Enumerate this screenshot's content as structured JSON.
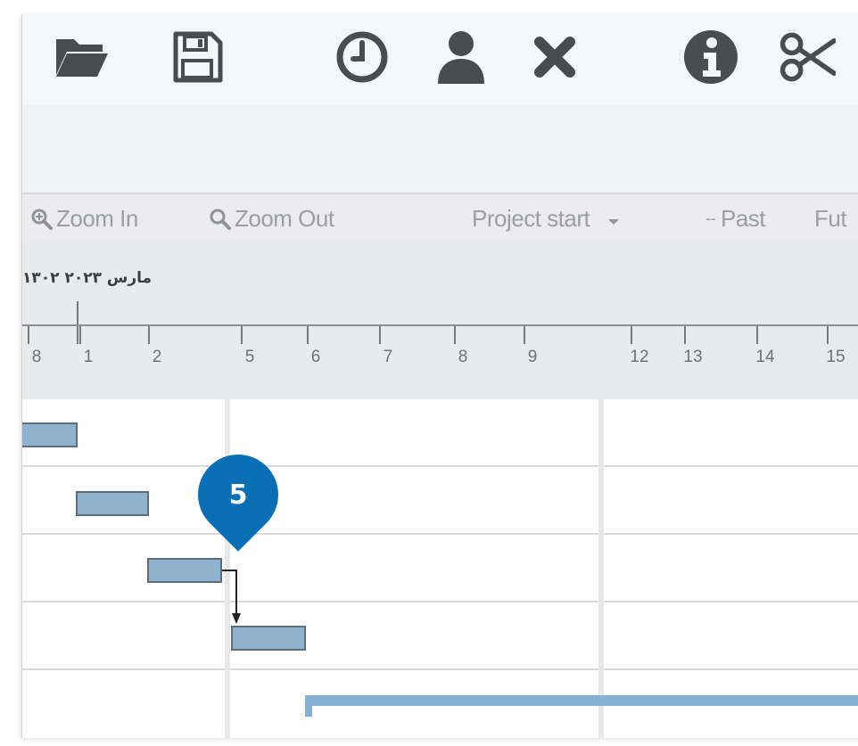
{
  "toolbar": {
    "icons": [
      "open-folder-icon",
      "save-icon",
      "history-clock-icon",
      "user-icon",
      "close-icon",
      "info-icon",
      "scissors-icon"
    ]
  },
  "gantt_toolbar": {
    "zoom_in_label": "Zoom In",
    "zoom_out_label": "Zoom Out",
    "project_start_label": "Project start",
    "past_label": "Past",
    "future_label": "Fut"
  },
  "timeline": {
    "month_label": "مارس ٢٠٢٣ ١٣٠٢",
    "day_ticks": [
      "8",
      "1",
      "2",
      "5",
      "6",
      "7",
      "8",
      "9",
      "12",
      "13",
      "14",
      "15"
    ]
  },
  "callout": {
    "number": "5"
  },
  "colors": {
    "task_bar": "#8fb2cf",
    "callout": "#0b6fb6"
  }
}
